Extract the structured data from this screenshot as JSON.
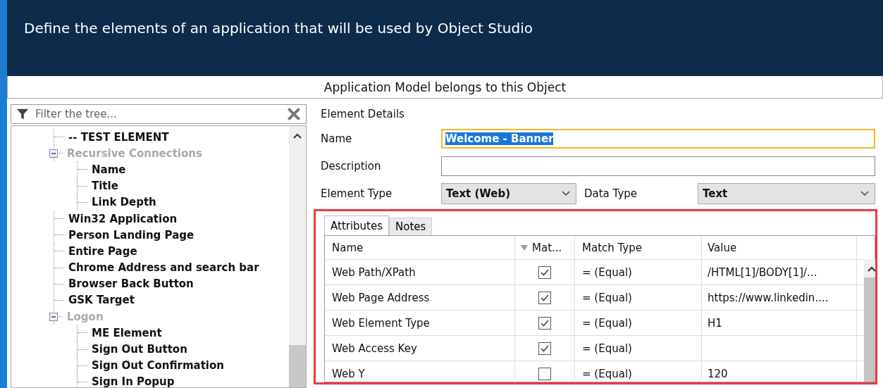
{
  "header": {
    "title": "Define the elements of an application that will be used by Object Studio"
  },
  "subheader": "Application Model belongs to this Object",
  "tree": {
    "filter_placeholder": "Filter the tree...",
    "items": [
      {
        "label": "-- TEST ELEMENT",
        "disabled": false
      },
      {
        "label": "Recursive Connections",
        "disabled": true,
        "expanded": true,
        "children": [
          {
            "label": "Name",
            "disabled": false
          },
          {
            "label": "Title",
            "disabled": false
          },
          {
            "label": "Link Depth",
            "disabled": false
          }
        ]
      },
      {
        "label": "Win32 Application",
        "disabled": false
      },
      {
        "label": "Person Landing Page",
        "disabled": false
      },
      {
        "label": "Entire Page",
        "disabled": false
      },
      {
        "label": "Chrome Address and search bar",
        "disabled": false
      },
      {
        "label": "Browser Back Button",
        "disabled": false
      },
      {
        "label": "GSK Target",
        "disabled": false
      },
      {
        "label": "Logon",
        "disabled": true,
        "expanded": true,
        "children": [
          {
            "label": "ME Element",
            "disabled": false
          },
          {
            "label": "Sign Out Button",
            "disabled": false
          },
          {
            "label": "Sign Out Confirmation",
            "disabled": false
          },
          {
            "label": "Sign In Popup",
            "disabled": false
          }
        ]
      }
    ]
  },
  "details": {
    "heading": "Element Details",
    "name": {
      "label": "Name",
      "value": "Welcome - Banner",
      "text_selected": true
    },
    "description": {
      "label": "Description"
    },
    "element_type": {
      "label": "Element Type",
      "value": "Text (Web)"
    },
    "data_type": {
      "label": "Data Type",
      "value": "Text"
    }
  },
  "tabs": [
    {
      "label": "Attributes",
      "selected": true
    },
    {
      "label": "Notes",
      "selected": false
    }
  ],
  "attributes": {
    "columns": [
      "Name",
      "Mat...",
      "Match Type",
      "Value"
    ],
    "rows": [
      {
        "name": "Web Path/XPath",
        "checked": true,
        "match_type": "=  (Equal)",
        "value": "/HTML[1]/BODY[1]/..."
      },
      {
        "name": "Web Page Address",
        "checked": true,
        "match_type": "=  (Equal)",
        "value": "https://www.linkedin...."
      },
      {
        "name": "Web Element Type",
        "checked": true,
        "match_type": "=  (Equal)",
        "value": "H1"
      },
      {
        "name": "Web Access Key",
        "checked": true,
        "match_type": "=  (Equal)"
      },
      {
        "name": "Web Y",
        "checked": false,
        "match_type": "=  (Equal)",
        "value": "120"
      }
    ]
  }
}
